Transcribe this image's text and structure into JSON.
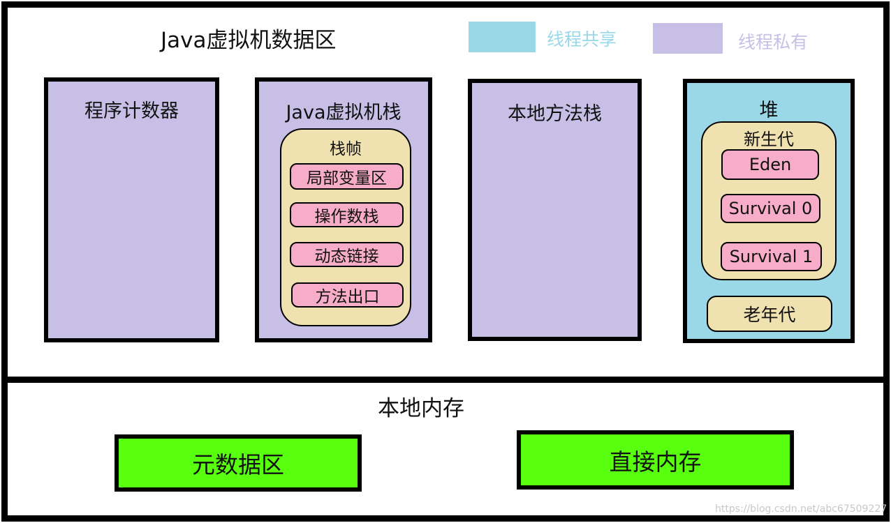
{
  "jvm": {
    "title": "Java虚拟机数据区",
    "legend": [
      {
        "label": "线程共享",
        "color": "#9ad8e8"
      },
      {
        "label": "线程私有",
        "color": "#c8bfe6"
      }
    ],
    "program_counter": "程序计数器",
    "vm_stack": {
      "title": "Java虚拟机栈",
      "frame_title": "栈帧",
      "items": [
        "局部变量区",
        "操作数栈",
        "动态链接",
        "方法出口"
      ]
    },
    "native_stack": "本地方法栈",
    "heap": {
      "title": "堆",
      "young_gen": "新生代",
      "young_items": [
        "Eden",
        "Survival 0",
        "Survival 1"
      ],
      "old_gen": "老年代"
    }
  },
  "native_memory": {
    "title": "本地内存",
    "metaspace": "元数据区",
    "direct_memory": "直接内存"
  },
  "watermark": "https://blog.csdn.net/abc67509227",
  "colors": {
    "private": "#c8bfe6",
    "shared": "#9ad8e8",
    "frame": "#f0e2b0",
    "slot": "#f7adc8",
    "native": "#58ff0e"
  }
}
